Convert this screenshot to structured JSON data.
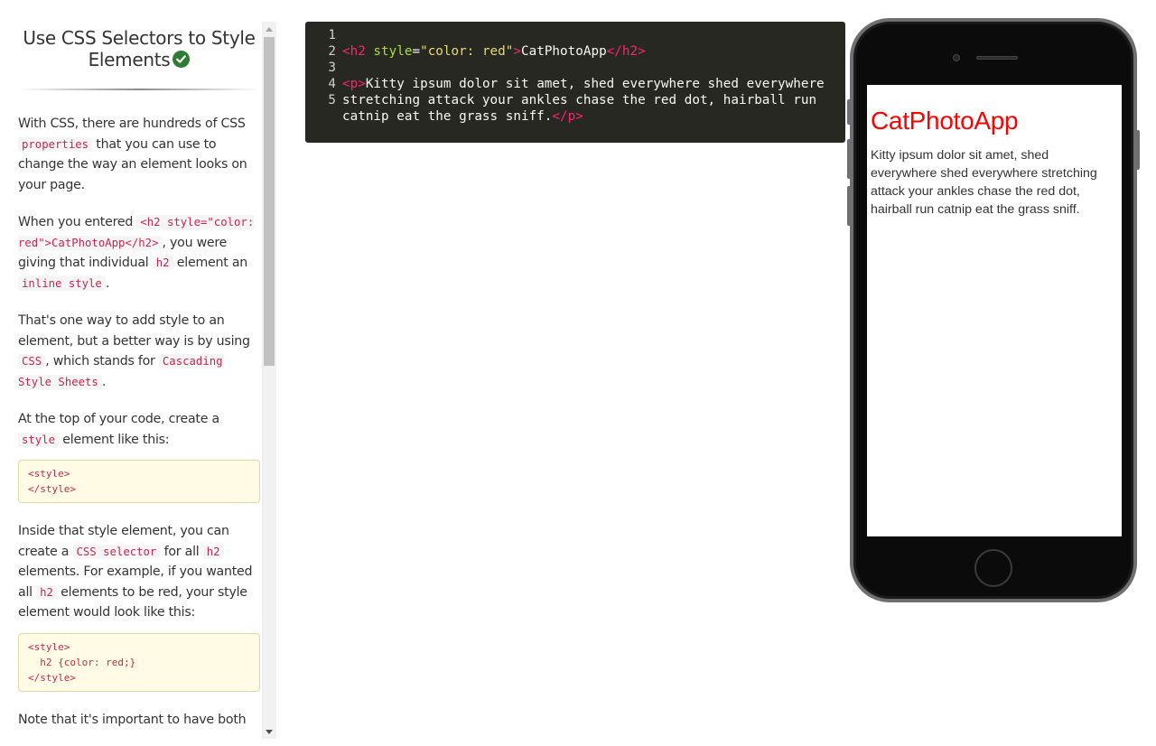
{
  "lesson": {
    "title": "Use CSS Selectors to Style Elements",
    "para1_a": "With CSS, there are hundreds of CSS ",
    "para1_code": "properties",
    "para1_b": " that you can use to change the way an element looks on your page.",
    "para2_a": "When you entered ",
    "para2_code1": "<h2 style=\"color: red\">CatPhotoApp</h2>",
    "para2_b": ", you were giving that individual ",
    "para2_code2": "h2",
    "para2_c": " element an ",
    "para2_code3": "inline style",
    "para2_d": ".",
    "para3_a": "That's one way to add style to an element, but a better way is by using ",
    "para3_code1": "CSS",
    "para3_b": ", which stands for ",
    "para3_code2": "Cascading Style Sheets",
    "para3_c": ".",
    "para4_a": "At the top of your code, create a ",
    "para4_code": "style",
    "para4_b": " element like this:",
    "code_block1": "<style>\n</style>",
    "para5_a": "Inside that style element, you can create a ",
    "para5_code1": "CSS selector",
    "para5_b": " for all ",
    "para5_code2": "h2",
    "para5_c": " elements. For example, if you wanted all ",
    "para5_code3": "h2",
    "para5_d": " elements to be red, your style element would look like this:",
    "code_block2": "<style>\n  h2 {color: red;}\n</style>",
    "para6": "Note that it's important to have both"
  },
  "editor": {
    "line_numbers": [
      "1",
      "2",
      "3",
      "4",
      "5"
    ],
    "line2": {
      "open_tag": "<h2",
      "attr_name": " style",
      "equals": "=",
      "attr_value": "\"color: red\"",
      "close_bracket": ">",
      "text": "CatPhotoApp",
      "end_tag": "</h2>"
    },
    "line4": {
      "open_tag": "<p>",
      "text": "Kitty ipsum dolor sit amet, shed everywhere shed everywhere stretching attack your ankles chase the red dot, hairball run catnip eat the grass sniff.",
      "end_tag": "</p>"
    }
  },
  "preview": {
    "heading": "CatPhotoApp",
    "heading_color": "#ff0000",
    "paragraph": "Kitty ipsum dolor sit amet, shed everywhere shed everywhere stretching attack your ankles chase the red dot, hairball run catnip eat the grass sniff."
  },
  "colors": {
    "editor_bg": "#272822",
    "tag": "#f92672",
    "attribute": "#a6e22e",
    "string": "#e6db74",
    "inline_code": "#c7254e",
    "code_block_bg": "#fffbe5",
    "check_badge": "#2e7d32"
  }
}
